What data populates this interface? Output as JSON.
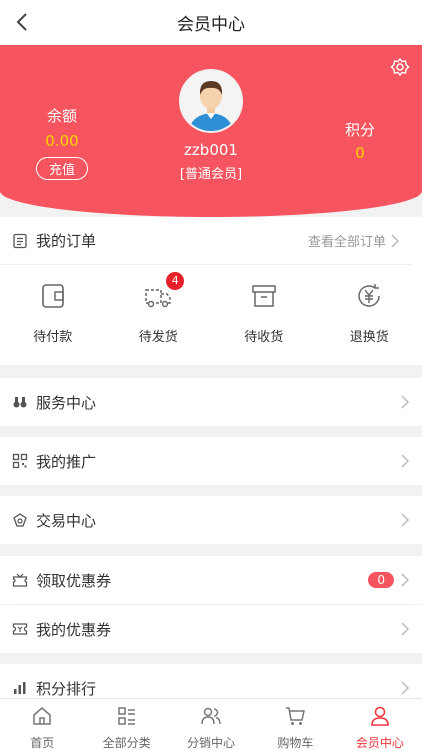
{
  "header": {
    "title": "会员中心"
  },
  "profile": {
    "balance_label": "余额",
    "balance_value": "0.00",
    "recharge_label": "充值",
    "points_label": "积分",
    "points_value": "0",
    "username": "zzb001",
    "level": "[普通会员]"
  },
  "orders": {
    "title": "我的订单",
    "view_all": "查看全部订单",
    "items": [
      {
        "label": "待付款",
        "icon": "wallet-icon"
      },
      {
        "label": "待发货",
        "icon": "truck-icon",
        "badge": "4"
      },
      {
        "label": "待收货",
        "icon": "box-icon"
      },
      {
        "label": "退换货",
        "icon": "yen-refund-icon"
      }
    ]
  },
  "menu": [
    {
      "label": "服务中心",
      "icon": "binoculars-icon"
    },
    {
      "label": "我的推广",
      "icon": "qrcode-icon"
    },
    {
      "label": "交易中心",
      "icon": "exchange-icon"
    },
    {
      "label": "领取优惠券",
      "icon": "coupon-get-icon",
      "count": "0"
    },
    {
      "label": "我的优惠券",
      "icon": "coupon-icon"
    },
    {
      "label": "积分排行",
      "icon": "bar-chart-icon"
    }
  ],
  "tabbar": [
    {
      "label": "首页",
      "icon": "home-icon"
    },
    {
      "label": "全部分类",
      "icon": "category-icon"
    },
    {
      "label": "分销中心",
      "icon": "users-icon"
    },
    {
      "label": "购物车",
      "icon": "cart-icon"
    },
    {
      "label": "会员中心",
      "icon": "user-icon",
      "active": true
    }
  ],
  "colors": {
    "brand": "#f6555f",
    "accent_yellow": "#ffd400",
    "active_tab": "#f0363f"
  }
}
